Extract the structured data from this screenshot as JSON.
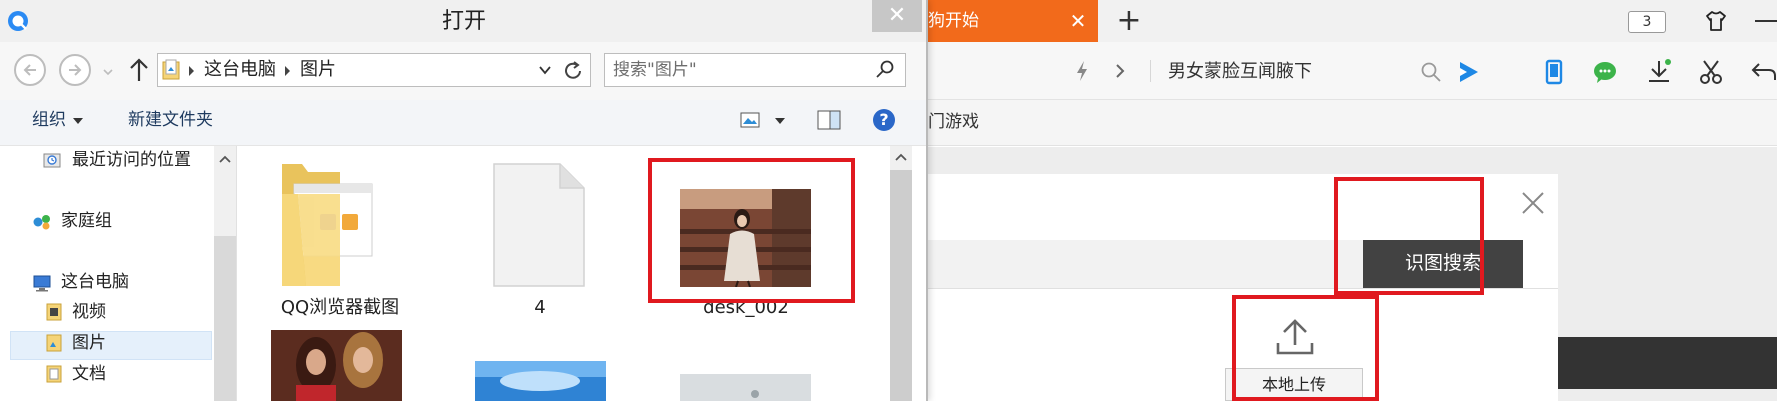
{
  "browser": {
    "active_tab_label": "狗开始",
    "tab_count": "3",
    "address_query": "男女蒙脸互闻腋下",
    "bookmark_text": "门游戏",
    "image_search_button": "识图搜索",
    "local_upload_button": "本地上传",
    "accent_color": "#f26a1b",
    "highlight_color": "#e0191f"
  },
  "dialog": {
    "title": "打开",
    "address_segments": [
      "这台电脑",
      "图片"
    ],
    "search_placeholder": "搜索\"图片\"",
    "toolbar": {
      "organize": "组织",
      "new_folder": "新建文件夹",
      "help": "?"
    },
    "nav_items": [
      {
        "label": "最近访问的位置",
        "icon": "recent-places-icon"
      },
      {
        "label": "家庭组",
        "icon": "homegroup-icon"
      },
      {
        "label": "这台电脑",
        "icon": "computer-icon"
      },
      {
        "label": "视频",
        "icon": "videos-folder-icon"
      },
      {
        "label": "图片",
        "icon": "pictures-folder-icon",
        "selected": true
      },
      {
        "label": "文档",
        "icon": "documents-folder-icon"
      }
    ],
    "files": [
      {
        "name": "QQ浏览器截图",
        "kind": "folder"
      },
      {
        "name": "4",
        "kind": "blank-file"
      },
      {
        "name": "desk_002",
        "kind": "image",
        "highlighted": true
      }
    ]
  }
}
